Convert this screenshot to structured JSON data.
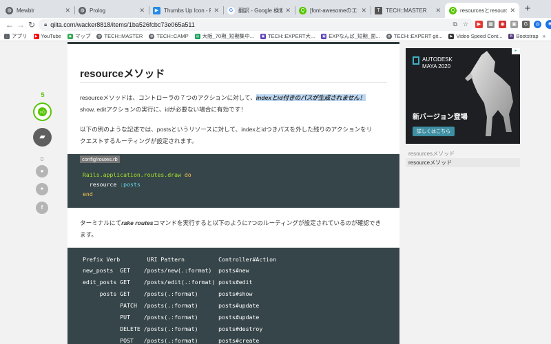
{
  "tabs": [
    {
      "title": "Mewblr",
      "icon": "globe-icon",
      "color": "#5f6368"
    },
    {
      "title": "Prolog",
      "icon": "globe-icon",
      "color": "#5f6368"
    },
    {
      "title": "Thumbs Up Icon - Reg",
      "icon": "fontawesome-icon",
      "color": "#228ae6"
    },
    {
      "title": "翻訳 - Google 検索",
      "icon": "google-icon",
      "color": "#4285f4"
    },
    {
      "title": "[font-awesomeのエラー]",
      "icon": "qiita-icon",
      "color": "#55c500"
    },
    {
      "title": "TECH::MASTER",
      "icon": "tm-icon",
      "color": "#555555"
    },
    {
      "title": "resourcesとresourceの",
      "icon": "qiita-icon",
      "color": "#55c500"
    }
  ],
  "toolbar": {
    "url": "qiita.com/wacker8818/items/1ba526fcbc73e065a511"
  },
  "bookmarks": [
    {
      "label": "アプリ",
      "color": "#5f6368"
    },
    {
      "label": "YouTube",
      "color": "#ff0000"
    },
    {
      "label": "マップ",
      "color": "#5f6368"
    },
    {
      "label": "TECH::MASTER",
      "color": "#5f6368"
    },
    {
      "label": "TECH::CAMP",
      "color": "#5f6368"
    },
    {
      "label": "大阪_70期_短期集中...",
      "color": "#0f9d58"
    },
    {
      "label": "TECH::EXPERT大...",
      "color": "#5b3fb8"
    },
    {
      "label": "EXPなんば_短期_面...",
      "color": "#5b3fb8"
    },
    {
      "label": "TECH::EXPERT git...",
      "color": "#5f6368"
    },
    {
      "label": "Video Speed Cont...",
      "color": "#333333"
    },
    {
      "label": "Bootstrap",
      "color": "#563d7c"
    }
  ],
  "article": {
    "heading": "resourceメソッド",
    "para1_a": "resourceメソッドは、コントローラの７つのアクションに対して、",
    "para1_hl": "indexとid付きのパスが生成されません！",
    "para1_b": "show, editアクションの実行に、idが必要ない場合に有効です！",
    "para2_a": "以下の例のような記述では、postsというリソースに対して、indexとidつきパスを外した残りのアクションをリ",
    "para2_b": "クエストするルーティングが設定されます。",
    "code_label": "config/routes.rb",
    "code_tokens": {
      "l1a": "Rails.application.routes.draw",
      "l1b": " do",
      "l2a": "  resource",
      "l2b": " :posts",
      "l3": "end"
    },
    "para3_a": "ターミナルにて",
    "para3_em": "rake routes",
    "para3_b": "コマンドを実行すると以下のように7つのルーティングが設定されているのが確認でき",
    "para3_c": "ます。",
    "routes_lines": [
      "Prefix Verb        URI Pattern          Controller#Action",
      "new_posts  GET    /posts/new(.:format)  posts#new",
      "edit_posts GET    /posts/edit(.:format) posts#edit",
      "     posts GET    /posts(.:format)      posts#show",
      "           PATCH  /posts(.:format)      posts#update",
      "           PUT    /posts(.:format)      posts#update",
      "           DELETE /posts(.:format)      posts#destroy",
      "           POST   /posts(.:format)      posts#create"
    ]
  },
  "actions": {
    "like_count": "5",
    "comment_count": "0"
  },
  "sidebar": {
    "ad": {
      "brand": "AUTODESK",
      "product": "MAYA 2020",
      "headline": "新バージョン登場",
      "cta": "詳しくはこちら"
    },
    "toc_title": "resourcesメソッド",
    "toc_item": "resourceメソッド"
  },
  "colors": {
    "qiita_green": "#55c500",
    "code_bg": "#364549",
    "highlight": "#bcd7f2"
  }
}
